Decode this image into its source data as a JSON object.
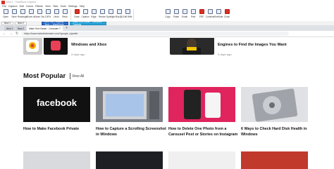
{
  "window": {
    "title": "Mob.1 - FastStone Capture"
  },
  "menu": [
    "File",
    "Capture",
    "Edit",
    "Colors",
    "Effects",
    "View",
    "Tabs",
    "Tools",
    "Settings",
    "Help"
  ],
  "toolbar": [
    "Open",
    "Save",
    "Rectangle",
    "Zoom In",
    "Zoom Out",
    "100%",
    "Undo",
    "Redo",
    "Draw",
    "Caption",
    "Edge",
    "Resize",
    "Spotlight",
    "Blur(B)",
    "Edit With",
    "Copy",
    "Paste",
    "Email",
    "Print",
    "PDF",
    "Combine",
    "OneNote",
    "Close"
  ],
  "doc_tabs": [
    "New 1",
    "New 2",
    "Edit Post ‹ Guiding Tech — WordPress",
    "Make Tech Easier · Computer Tutorials"
  ],
  "browser": {
    "tabs": [
      "New 1",
      "New 2",
      "Make Tech Easier · Computer T"
    ],
    "url": "https://www.maketecheasier.com/?google_vignette"
  },
  "top_articles": [
    {
      "title": "Windows and Xbox",
      "date": "3 days ago"
    },
    {
      "title": "Engines to Find the Images You Want",
      "date": "3 days ago"
    }
  ],
  "section": {
    "title": "Most Popular",
    "view_all": "View All"
  },
  "cards": [
    {
      "title": "How to Make Facebook Private",
      "image_text": "facebook"
    },
    {
      "title": "How to Capture a Scrolling Screenshot in Windows"
    },
    {
      "title": "How to Delete One Photo from a Carousel Post or Stories on Instagram"
    },
    {
      "title": "6 Ways to Check Hard Disk Health in Windows"
    }
  ],
  "colors": {
    "accent_blue": "#2a6cc8",
    "instagram_red": "#e0245e"
  }
}
